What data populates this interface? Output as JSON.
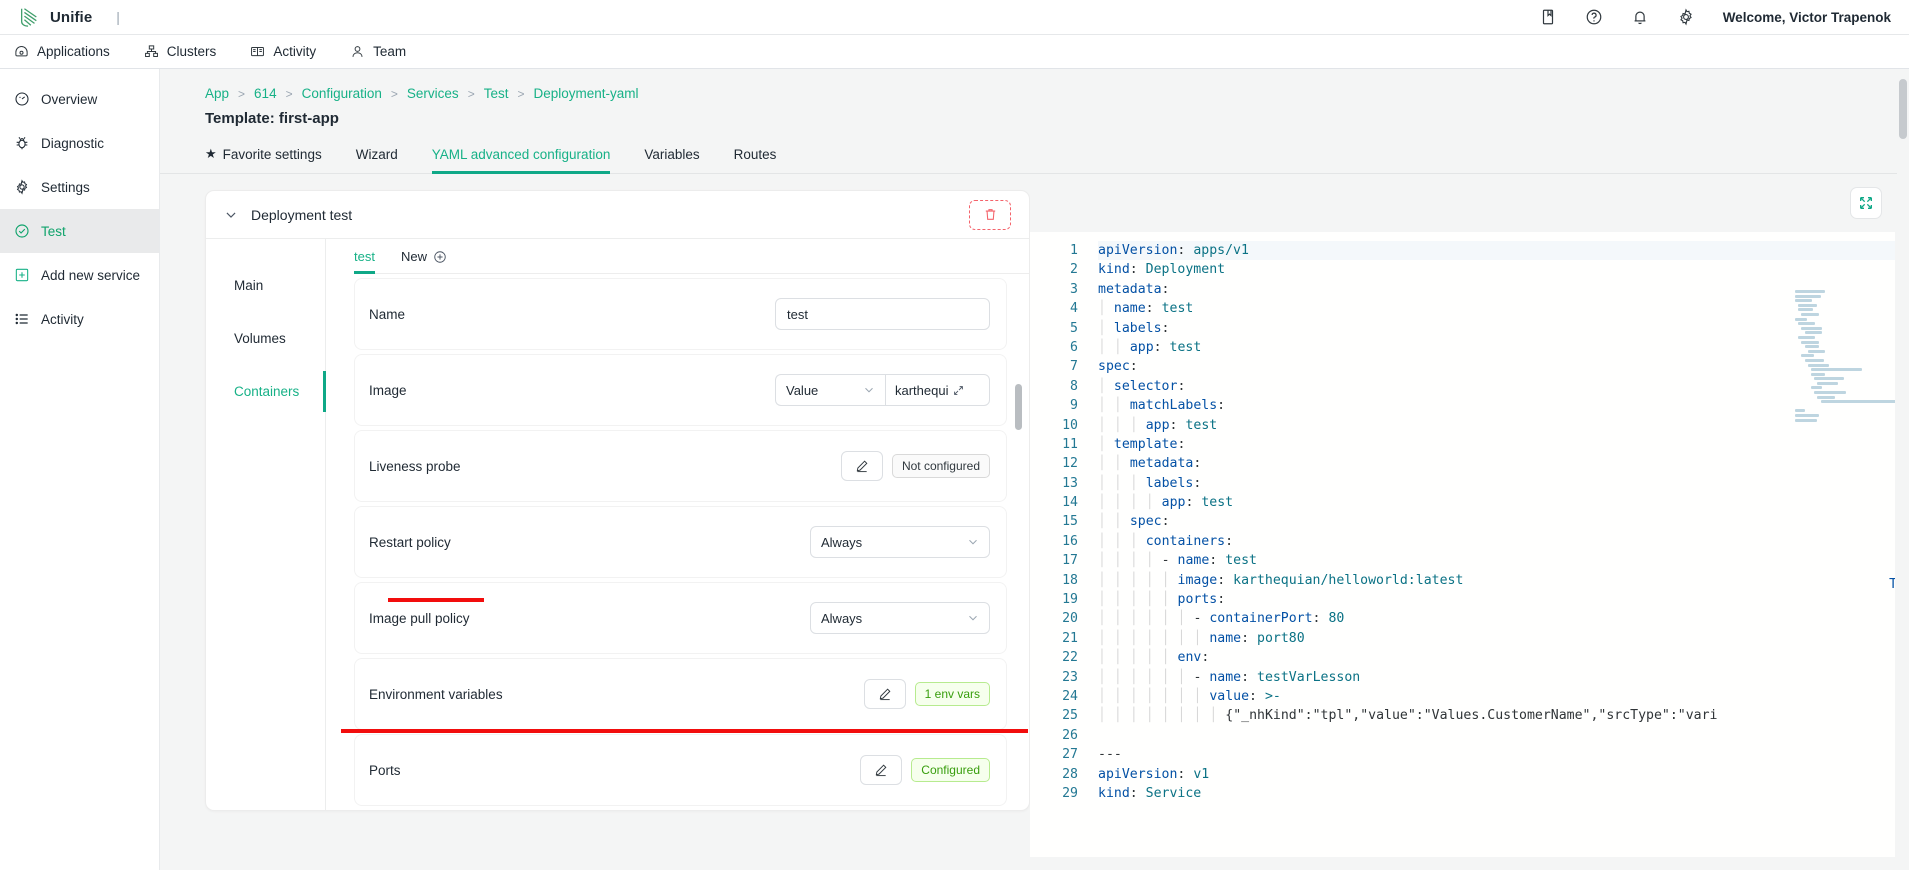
{
  "topbar": {
    "brand": "Unifie",
    "separator": "|",
    "icons": [
      "book-icon",
      "help-circle-icon",
      "bell-icon",
      "gear-icon"
    ],
    "welcome": "Welcome, Victor Trapenok"
  },
  "navbar": {
    "items": [
      {
        "label": "Applications",
        "icon": "apps-icon"
      },
      {
        "label": "Clusters",
        "icon": "cluster-icon"
      },
      {
        "label": "Activity",
        "icon": "activity-book-icon"
      },
      {
        "label": "Team",
        "icon": "user-icon"
      }
    ]
  },
  "sidebar": {
    "items": [
      {
        "label": "Overview",
        "icon": "gauge-icon",
        "active": false
      },
      {
        "label": "Diagnostic",
        "icon": "bug-icon",
        "active": false
      },
      {
        "label": "Settings",
        "icon": "gear-icon",
        "active": false
      },
      {
        "label": "Test",
        "icon": "check-circle-icon",
        "active": true
      },
      {
        "label": "Add new service",
        "icon": "plus-square-icon",
        "active": false
      },
      {
        "label": "Activity",
        "icon": "list-icon",
        "active": false
      }
    ]
  },
  "breadcrumb": {
    "items": [
      "App",
      "614",
      "Configuration",
      "Services",
      "Test",
      "Deployment-yaml"
    ],
    "separator": ">"
  },
  "page": {
    "title": "Template: first-app"
  },
  "tabs": [
    {
      "label": "Favorite settings",
      "icon": "star-icon",
      "active": false
    },
    {
      "label": "Wizard",
      "active": false
    },
    {
      "label": "YAML advanced configuration",
      "active": true
    },
    {
      "label": "Variables",
      "active": false
    },
    {
      "label": "Routes",
      "active": false
    }
  ],
  "panel": {
    "title": "Deployment test",
    "collapse_icon": "chevron-down-icon",
    "delete_icon": "trash-icon",
    "sub_nav": [
      {
        "label": "Main",
        "active": false
      },
      {
        "label": "Volumes",
        "active": false
      },
      {
        "label": "Containers",
        "active": true,
        "highlighted": true
      }
    ],
    "container_tabs": [
      {
        "label": "test",
        "active": true
      },
      {
        "label": "New",
        "icon": "plus-circle-icon",
        "active": false
      }
    ],
    "fields": [
      {
        "label": "Name",
        "type": "text",
        "value": "test",
        "placeholder": ""
      },
      {
        "label": "Image",
        "type": "combo",
        "select_value": "Value",
        "value": "karthequi",
        "expand_icon": "expand-arrows-icon"
      },
      {
        "label": "Liveness probe",
        "type": "action",
        "edit_icon": "pencil-icon",
        "badge": "Not configured",
        "badge_style": "grey"
      },
      {
        "label": "Restart policy",
        "type": "select",
        "value": "Always"
      },
      {
        "label": "Image pull policy",
        "type": "select",
        "value": "Always"
      },
      {
        "label": "Environment variables",
        "type": "action",
        "edit_icon": "pencil-icon",
        "badge": "1 env vars",
        "badge_style": "green",
        "highlighted": true
      },
      {
        "label": "Ports",
        "type": "action",
        "edit_icon": "pencil-icon",
        "badge": "Configured",
        "badge_style": "green"
      }
    ]
  },
  "editor": {
    "expand_icon": "expand-icon",
    "overflow_text": "Ty",
    "lines": [
      {
        "n": 1,
        "text": "apiVersion: apps/v1"
      },
      {
        "n": 2,
        "text": "kind: Deployment"
      },
      {
        "n": 3,
        "text": "metadata:"
      },
      {
        "n": 4,
        "text": "  name: test"
      },
      {
        "n": 5,
        "text": "  labels:"
      },
      {
        "n": 6,
        "text": "    app: test"
      },
      {
        "n": 7,
        "text": "spec:"
      },
      {
        "n": 8,
        "text": "  selector:"
      },
      {
        "n": 9,
        "text": "    matchLabels:"
      },
      {
        "n": 10,
        "text": "      app: test"
      },
      {
        "n": 11,
        "text": "  template:"
      },
      {
        "n": 12,
        "text": "    metadata:"
      },
      {
        "n": 13,
        "text": "      labels:"
      },
      {
        "n": 14,
        "text": "        app: test"
      },
      {
        "n": 15,
        "text": "    spec:"
      },
      {
        "n": 16,
        "text": "      containers:"
      },
      {
        "n": 17,
        "text": "        - name: test"
      },
      {
        "n": 18,
        "text": "          image: karthequian/helloworld:latest"
      },
      {
        "n": 19,
        "text": "          ports:"
      },
      {
        "n": 20,
        "text": "            - containerPort: 80"
      },
      {
        "n": 21,
        "text": "              name: port80"
      },
      {
        "n": 22,
        "text": "          env:"
      },
      {
        "n": 23,
        "text": "            - name: testVarLesson"
      },
      {
        "n": 24,
        "text": "              value: >-"
      },
      {
        "n": 25,
        "text": "                {\"_nhKind\":\"tpl\",\"value\":\"Values.CustomerName\",\"srcType\":\"vari"
      },
      {
        "n": 26,
        "text": ""
      },
      {
        "n": 27,
        "text": "---"
      },
      {
        "n": 28,
        "text": "apiVersion: v1"
      },
      {
        "n": 29,
        "text": "kind: Service"
      }
    ]
  },
  "colors": {
    "accent": "#17b187",
    "accent_dark": "#0fa887",
    "danger": "#f20d0d",
    "delete": "#f4636b",
    "badge_green_text": "#389e0d",
    "badge_green_bg": "#f6ffed",
    "code_key": "#0451a5",
    "code_value": "#0b7285",
    "gutter": "#237893"
  }
}
